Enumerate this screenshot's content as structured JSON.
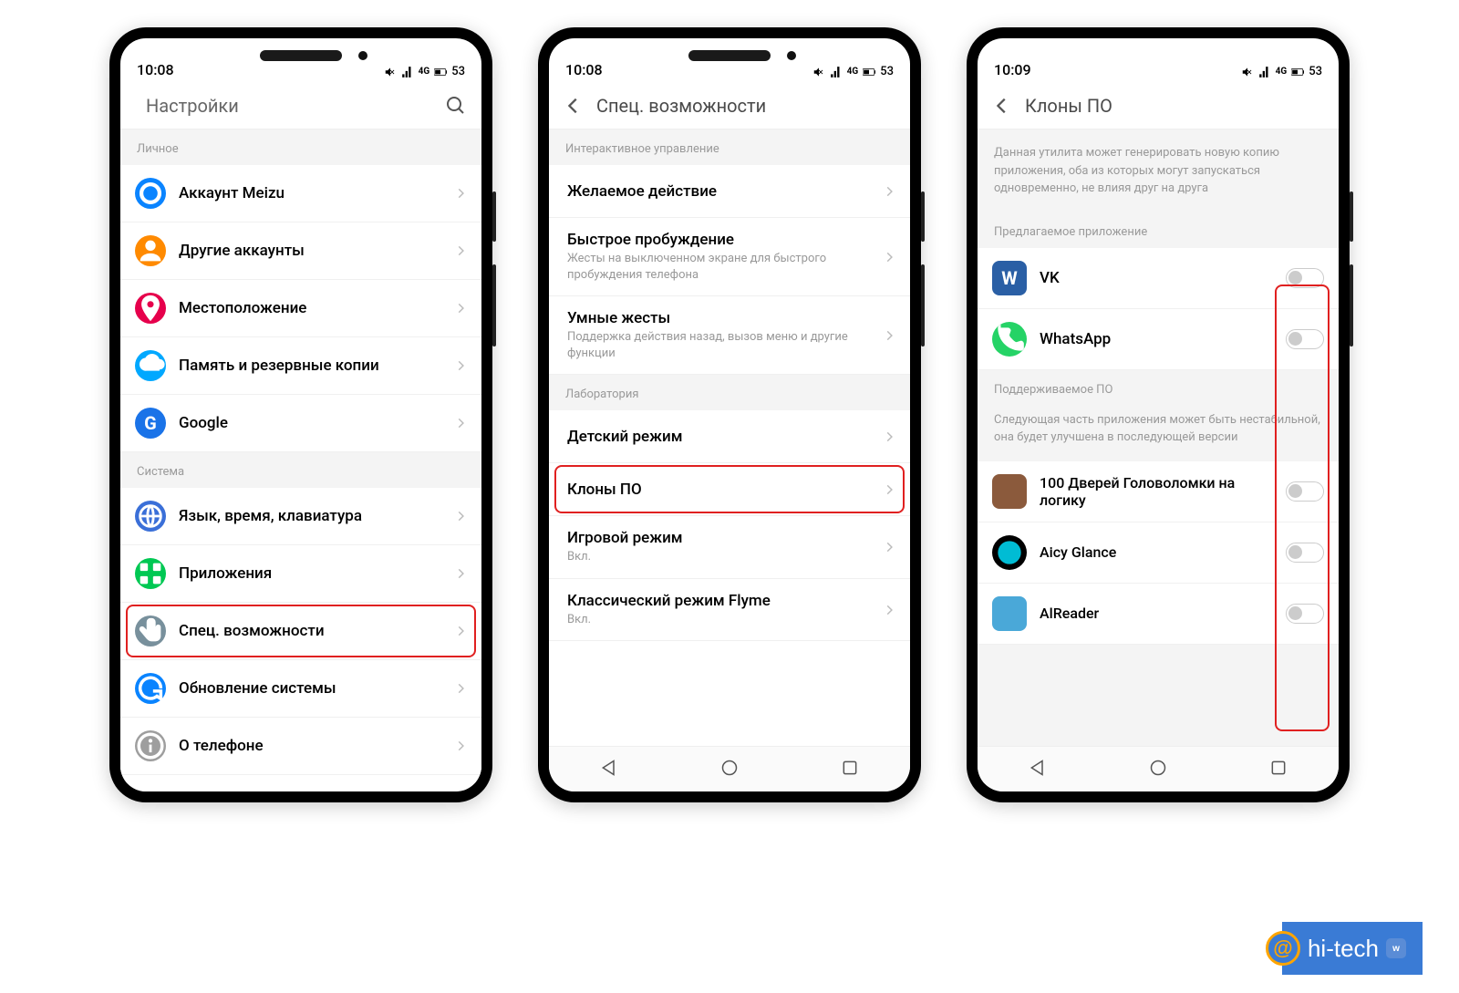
{
  "watermark": "hi-tech",
  "phone1": {
    "time": "10:08",
    "battery": "53",
    "net": "4G",
    "title": "Настройки",
    "sections": [
      {
        "header": "Личное",
        "items": [
          {
            "label": "Аккаунт Meizu",
            "icon_bg": "#0a84ff",
            "icon": "meizu"
          },
          {
            "label": "Другие аккаунты",
            "icon_bg": "#ff8a00",
            "icon": "user"
          },
          {
            "label": "Местоположение",
            "icon_bg": "#e6004c",
            "icon": "pin"
          },
          {
            "label": "Память и резервные копии",
            "icon_bg": "#00a8ff",
            "icon": "cloud"
          },
          {
            "label": "Google",
            "icon_bg": "#1a73e8",
            "icon": "g"
          }
        ]
      },
      {
        "header": "Система",
        "items": [
          {
            "label": "Язык, время, клавиатура",
            "icon_bg": "#3a6fd8",
            "icon": "globe"
          },
          {
            "label": "Приложения",
            "icon_bg": "#00c853",
            "icon": "apps"
          },
          {
            "label": "Спец. возможности",
            "icon_bg": "#78909c",
            "icon": "hand",
            "hl": true
          },
          {
            "label": "Обновление системы",
            "icon_bg": "#0a84ff",
            "icon": "refresh"
          },
          {
            "label": "О телефоне",
            "icon_bg": "#9e9e9e",
            "icon": "info"
          }
        ]
      }
    ]
  },
  "phone2": {
    "time": "10:08",
    "battery": "53",
    "net": "4G",
    "title": "Спец. возможности",
    "sections": [
      {
        "header": "Интерактивное управление",
        "items": [
          {
            "label": "Желаемое действие"
          },
          {
            "label": "Быстрое пробуждение",
            "sub": "Жесты на выключенном экране для быстрого пробуждения телефона"
          },
          {
            "label": "Умные жесты",
            "sub": "Поддержка действия назад, вызов меню и другие функции"
          }
        ]
      },
      {
        "header": "Лаборатория",
        "items": [
          {
            "label": "Детский режим"
          },
          {
            "label": "Клоны ПО",
            "hl": true
          },
          {
            "label": "Игровой режим",
            "sub": "Вкл."
          },
          {
            "label": "Классический режим Flyme",
            "sub": "Вкл."
          }
        ]
      }
    ]
  },
  "phone3": {
    "time": "10:09",
    "battery": "53",
    "net": "4G",
    "title": "Клоны ПО",
    "desc": "Данная утилита может генерировать новую копию приложения, оба из которых могут запускаться одновременно, не влияя друг на друга",
    "section1_header": "Предлагаемое приложение",
    "section1_items": [
      {
        "label": "VK",
        "icon_bg": "#2a5fa5",
        "icon_text": "W"
      },
      {
        "label": "WhatsApp",
        "icon_bg": "#25d366",
        "icon": "phone"
      }
    ],
    "section2_header": "Поддерживаемое ПО",
    "section2_desc": "Следующая часть приложения может быть нестабильной, она будет улучшена в последующей версии",
    "section2_items": [
      {
        "label": "100 Дверей Головоломки на логику",
        "icon_bg": "#8b5a3c"
      },
      {
        "label": "Aicy Glance",
        "icon_bg": "#000",
        "icon": "circle"
      },
      {
        "label": "AlReader",
        "icon_bg": "#4aa8d8"
      }
    ]
  }
}
